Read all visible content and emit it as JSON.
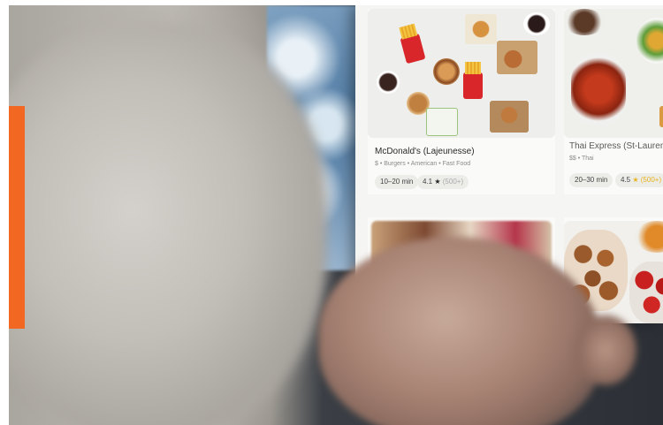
{
  "restaurants": [
    {
      "name": "McDonald's (Lajeunesse)",
      "meta": "$ • Burgers • American • Fast Food",
      "eta": "10–20 min",
      "rating": "4.1",
      "reviews": "(500+)"
    },
    {
      "name": "Thai Express (St-Laurent)",
      "meta": "$$ • Thai",
      "eta": "20–30 min",
      "rating": "4.5",
      "reviews": "(500+)"
    }
  ],
  "icons": {
    "rating": "star-icon"
  },
  "colors": {
    "accent_bar": "#f26722",
    "mcdonalds_red": "#d8262a",
    "rating_star": "#e8b31c"
  }
}
